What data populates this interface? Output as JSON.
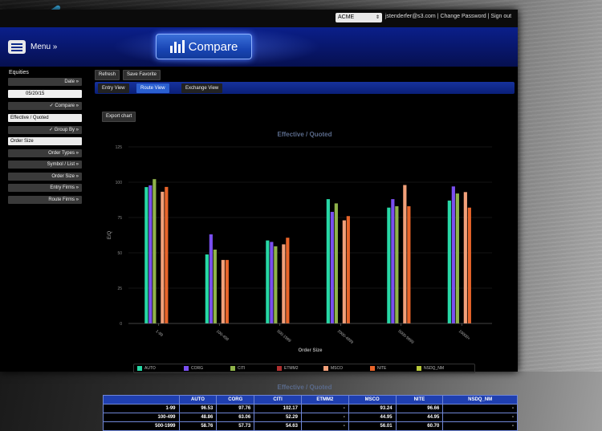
{
  "topbar": {
    "account_selected": "ACME",
    "user_email": "jstenderfer@s3.com",
    "change_password": "Change Password",
    "sign_out": "Sign out",
    "separator": "|"
  },
  "header": {
    "menu_label": "Menu »",
    "compare_label": "Compare"
  },
  "sidebar": {
    "title": "Equities",
    "date_button": "Date »",
    "date_value": "05/20/15",
    "compare_button": "✓ Compare »",
    "compare_select": "Effective / Quoted",
    "group_by_button": "✓ Group By »",
    "group_by_select": "Order Size",
    "filters": [
      "Order Types »",
      "Symbol / List »",
      "Order Size »",
      "Entry Firms »",
      "Route Firms »"
    ]
  },
  "toolbar": {
    "refresh": "Refresh",
    "save_favorite": "Save Favorite"
  },
  "tabs": [
    {
      "label": "Entry View",
      "active": false
    },
    {
      "label": "Route View",
      "active": true
    },
    {
      "label": "Exchange View",
      "active": false
    }
  ],
  "export_label": "Export chart",
  "chart_data": {
    "type": "bar",
    "title": "Effective / Quoted",
    "xlabel": "Order Size",
    "ylabel": "E/Q",
    "ylim": [
      0,
      125
    ],
    "yticks": [
      "0",
      "25",
      "50",
      "75",
      "100",
      "125"
    ],
    "categories": [
      "1-99",
      "100-499",
      "500-1999",
      "2000-4999",
      "5000-9999",
      "10000+"
    ],
    "series": [
      {
        "name": "AUTO",
        "color": "#27d8a6",
        "values": [
          96.53,
          48.86,
          58.76,
          88,
          82,
          87
        ]
      },
      {
        "name": "CORG",
        "color": "#7a4ff0",
        "values": [
          97.76,
          63.06,
          57.73,
          79,
          88,
          97
        ]
      },
      {
        "name": "CITI",
        "color": "#8fb34a",
        "values": [
          102.17,
          52.29,
          54.63,
          85,
          83,
          92
        ]
      },
      {
        "name": "ETMM2",
        "color": "#b03030",
        "values": [
          null,
          null,
          null,
          null,
          null,
          null
        ]
      },
      {
        "name": "MSCO",
        "color": "#f2a07a",
        "values": [
          93.24,
          44.95,
          56.01,
          73,
          98,
          93
        ]
      },
      {
        "name": "NITE",
        "color": "#e8642a",
        "values": [
          96.66,
          44.95,
          60.7,
          76,
          83,
          82
        ]
      },
      {
        "name": "NSDQ_NM",
        "color": "#b8c83a",
        "values": [
          null,
          null,
          null,
          null,
          null,
          null
        ]
      }
    ],
    "legend_position": "bottom"
  },
  "table": {
    "title": "Effective / Quoted",
    "columns": [
      "",
      "AUTO",
      "CORG",
      "CITI",
      "ETMM2",
      "MSCO",
      "NITE",
      "NSDQ_NM"
    ],
    "rows": [
      [
        "1-99",
        "96.53",
        "97.76",
        "102.17",
        "-",
        "93.24",
        "96.66",
        "-"
      ],
      [
        "100-499",
        "48.86",
        "63.06",
        "52.29",
        "-",
        "44.95",
        "44.95",
        "-"
      ],
      [
        "500-1999",
        "58.76",
        "57.73",
        "54.63",
        "-",
        "56.01",
        "60.70",
        "-"
      ]
    ]
  },
  "colors": {
    "header_blue": "#0a1f8a",
    "accent_blue": "#2a5fd0",
    "table_header": "#1f3fb0"
  },
  "icons": {
    "logo": "s3-logo-icon",
    "menu": "menu-icon",
    "compare": "bar-chart-icon"
  }
}
